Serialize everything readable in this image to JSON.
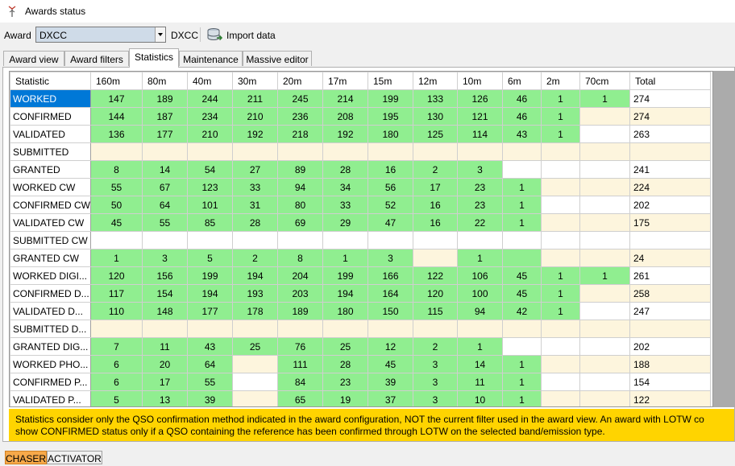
{
  "window": {
    "title": "Awards status"
  },
  "toolbar": {
    "award_label": "Award",
    "award_value": "DXCC",
    "award_code": "DXCC",
    "import_label": "Import data"
  },
  "tabs": [
    "Award view",
    "Award filters",
    "Statistics",
    "Maintenance",
    "Massive editor"
  ],
  "active_tab": "Statistics",
  "grid": {
    "columns": [
      "Statistic",
      "160m",
      "80m",
      "40m",
      "30m",
      "20m",
      "17m",
      "15m",
      "12m",
      "10m",
      "6m",
      "2m",
      "70cm",
      "Total"
    ],
    "rows": [
      {
        "label": "WORKED",
        "selected": true,
        "values": [
          "147",
          "189",
          "244",
          "211",
          "245",
          "214",
          "199",
          "133",
          "126",
          "46",
          "1",
          "1"
        ],
        "fills": "gggggggggggg",
        "total": "274"
      },
      {
        "label": "CONFIRMED",
        "values": [
          "144",
          "187",
          "234",
          "210",
          "236",
          "208",
          "195",
          "130",
          "121",
          "46",
          "1",
          ""
        ],
        "fills": "gggggggggggy",
        "total": "274"
      },
      {
        "label": "VALIDATED",
        "values": [
          "136",
          "177",
          "210",
          "192",
          "218",
          "192",
          "180",
          "125",
          "114",
          "43",
          "1",
          ""
        ],
        "fills": "gggggggggggw",
        "total": "263"
      },
      {
        "label": "SUBMITTED",
        "values": [
          "",
          "",
          "",
          "",
          "",
          "",
          "",
          "",
          "",
          "",
          "",
          ""
        ],
        "fills": "yyyyyyyyyyyy",
        "total": ""
      },
      {
        "label": "GRANTED",
        "values": [
          "8",
          "14",
          "54",
          "27",
          "89",
          "28",
          "16",
          "2",
          "3",
          "",
          "",
          ""
        ],
        "fills": "gggggggggwww",
        "total": "241"
      },
      {
        "label": "WORKED CW",
        "values": [
          "55",
          "67",
          "123",
          "33",
          "94",
          "34",
          "56",
          "17",
          "23",
          "1",
          "",
          ""
        ],
        "fills": "ggggggggggyy",
        "total": "224"
      },
      {
        "label": "CONFIRMED CW",
        "values": [
          "50",
          "64",
          "101",
          "31",
          "80",
          "33",
          "52",
          "16",
          "23",
          "1",
          "",
          ""
        ],
        "fills": "ggggggggggww",
        "total": "202"
      },
      {
        "label": "VALIDATED CW",
        "values": [
          "45",
          "55",
          "85",
          "28",
          "69",
          "29",
          "47",
          "16",
          "22",
          "1",
          "",
          ""
        ],
        "fills": "ggggggggggyy",
        "total": "175"
      },
      {
        "label": "SUBMITTED CW",
        "values": [
          "",
          "",
          "",
          "",
          "",
          "",
          "",
          "",
          "",
          "",
          "",
          ""
        ],
        "fills": "wwwwwwwwwwww",
        "total": ""
      },
      {
        "label": "GRANTED CW",
        "values": [
          "1",
          "3",
          "5",
          "2",
          "8",
          "1",
          "3",
          "",
          "1",
          "",
          "",
          ""
        ],
        "fills": "gggggggyggyy",
        "total": "24"
      },
      {
        "label": "WORKED DIGI...",
        "values": [
          "120",
          "156",
          "199",
          "194",
          "204",
          "199",
          "166",
          "122",
          "106",
          "45",
          "1",
          "1"
        ],
        "fills": "gggggggggggg",
        "total": "261"
      },
      {
        "label": "CONFIRMED D...",
        "values": [
          "117",
          "154",
          "194",
          "193",
          "203",
          "194",
          "164",
          "120",
          "100",
          "45",
          "1",
          ""
        ],
        "fills": "gggggggggggy",
        "total": "258"
      },
      {
        "label": "VALIDATED D...",
        "values": [
          "110",
          "148",
          "177",
          "178",
          "189",
          "180",
          "150",
          "115",
          "94",
          "42",
          "1",
          ""
        ],
        "fills": "gggggggggggw",
        "total": "247"
      },
      {
        "label": "SUBMITTED D...",
        "values": [
          "",
          "",
          "",
          "",
          "",
          "",
          "",
          "",
          "",
          "",
          "",
          ""
        ],
        "fills": "yyyyyyyyyyyy",
        "total": ""
      },
      {
        "label": "GRANTED DIG...",
        "values": [
          "7",
          "11",
          "43",
          "25",
          "76",
          "25",
          "12",
          "2",
          "1",
          "",
          "",
          ""
        ],
        "fills": "gggggggggwww",
        "total": "202"
      },
      {
        "label": "WORKED PHO...",
        "values": [
          "6",
          "20",
          "64",
          "",
          "111",
          "28",
          "45",
          "3",
          "14",
          "1",
          "",
          ""
        ],
        "fills": "gggyggggggyy",
        "total": "188"
      },
      {
        "label": "CONFIRMED P...",
        "values": [
          "6",
          "17",
          "55",
          "",
          "84",
          "23",
          "39",
          "3",
          "11",
          "1",
          "",
          ""
        ],
        "fills": "gggwggggggww",
        "total": "154"
      },
      {
        "label": "VALIDATED P...",
        "values": [
          "5",
          "13",
          "39",
          "",
          "65",
          "19",
          "37",
          "3",
          "10",
          "1",
          "",
          ""
        ],
        "fills": "gggyggggggyy",
        "total": "122"
      }
    ]
  },
  "colors": {
    "green_cell": "#90ee90",
    "cream_cell": "#fdf5dd",
    "selected_row": "#0078d7",
    "notice_bg": "#ffd400",
    "chaser_tab": "#f7a94a"
  },
  "notice": {
    "line1": "Statistics consider only the QSO confirmation method indicated in the award configuration, NOT the current filter used in the award view. An award with LOTW co",
    "line2": "show CONFIRMED status only if a QSO containing the reference has been confirmed through LOTW on the selected band/emission type."
  },
  "bottom_tabs": [
    "CHASER",
    "ACTIVATOR"
  ]
}
